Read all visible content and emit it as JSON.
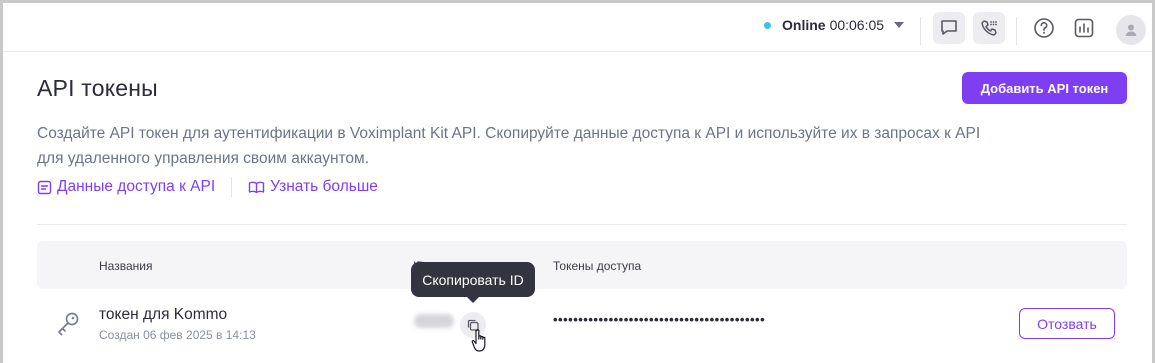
{
  "topbar": {
    "status_label": "Online",
    "status_time": "00:06:05",
    "status_color": "#3dbfe8",
    "icons": [
      "chat-icon",
      "phone-icon",
      "help-icon",
      "stats-icon",
      "user-avatar-icon"
    ]
  },
  "page": {
    "title": "API токены",
    "add_button": "Добавить API токен",
    "description": "Создайте API токен для аутентификации в Voximplant Kit API. Скопируйте данные доступа к API и используйте их в запросах к API для удаленного управления своим аккаунтом.",
    "link_access": "Данные доступа к API",
    "link_learn": "Узнать больше"
  },
  "table": {
    "columns": [
      "Названия",
      "ID",
      "Токены доступа"
    ],
    "rows": [
      {
        "name": "токен для Kommo",
        "created": "Создан 06 фев 2025 в 14:13",
        "token": "••••••••••••••••••••••••••••••••••••••••••",
        "revoke": "Отозвать"
      }
    ]
  },
  "tooltip": "Скопировать ID",
  "colors": {
    "accent": "#7e3ff2",
    "text": "#2c2c39",
    "muted": "#6c7486"
  }
}
